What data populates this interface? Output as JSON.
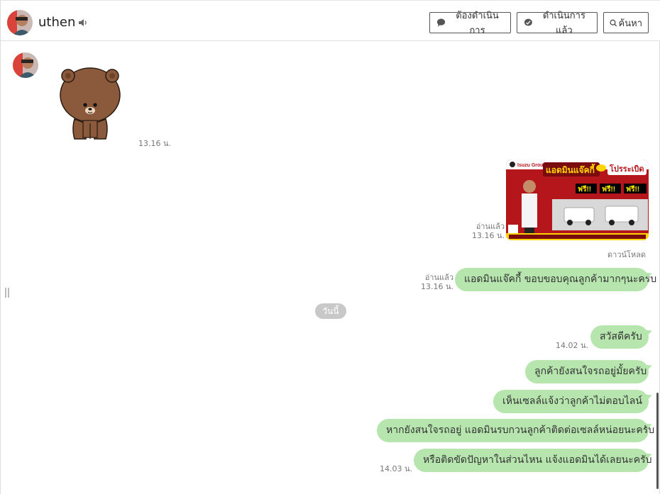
{
  "header": {
    "contact_name": "uthen",
    "btn_todo": "ต้องดำเนินการ",
    "btn_done": "ดำเนินการแล้ว",
    "btn_search": "ค้นหา"
  },
  "messages": {
    "sticker_time": "13.16 น.",
    "image_read": "อ่านแล้ว",
    "image_time": "13.16 น.",
    "download_label": "ดาวน์โหลด",
    "image_poster": {
      "brand": "Isuzu Group",
      "headline": "แอดมินแจ๊คกี้",
      "promo": "โปรระเบิด",
      "free1": "ฟรี!!",
      "free2": "ฟรี!!",
      "free3": "ฟรี!!"
    },
    "msg1_read": "อ่านแล้ว",
    "msg1_time": "13.16 น.",
    "msg1_text": "แอดมินแจ๊คกี้ ขอบขอบคุณลูกค้ามากๆนะครับ",
    "day_separator": "วันนี้",
    "msg2_text": "สวัสดีครับ",
    "msg2_time": "14.02 น.",
    "msg3_text": "ลูกค้ายังสนใจรถอยู่มั้ยครับ",
    "msg4_text": "เห็นเซลล์แจ้งว่าลูกค้าไม่ตอบไลน์",
    "msg5_text": "หากยังสนใจรถอยู่ แอดมินรบกวนลูกค้าติดต่อเซลล์หน่อยนะครับ",
    "msg6_text": "หรือติดขัดปัญหาในส่วนไหน แจ้งแอดมินได้เลยนะครับ",
    "msg6_time": "14.03 น."
  },
  "colors": {
    "bubble": "#b6e5ae",
    "day_badge": "#c8c8c8",
    "sticker_brown": "#8b5a3c"
  }
}
